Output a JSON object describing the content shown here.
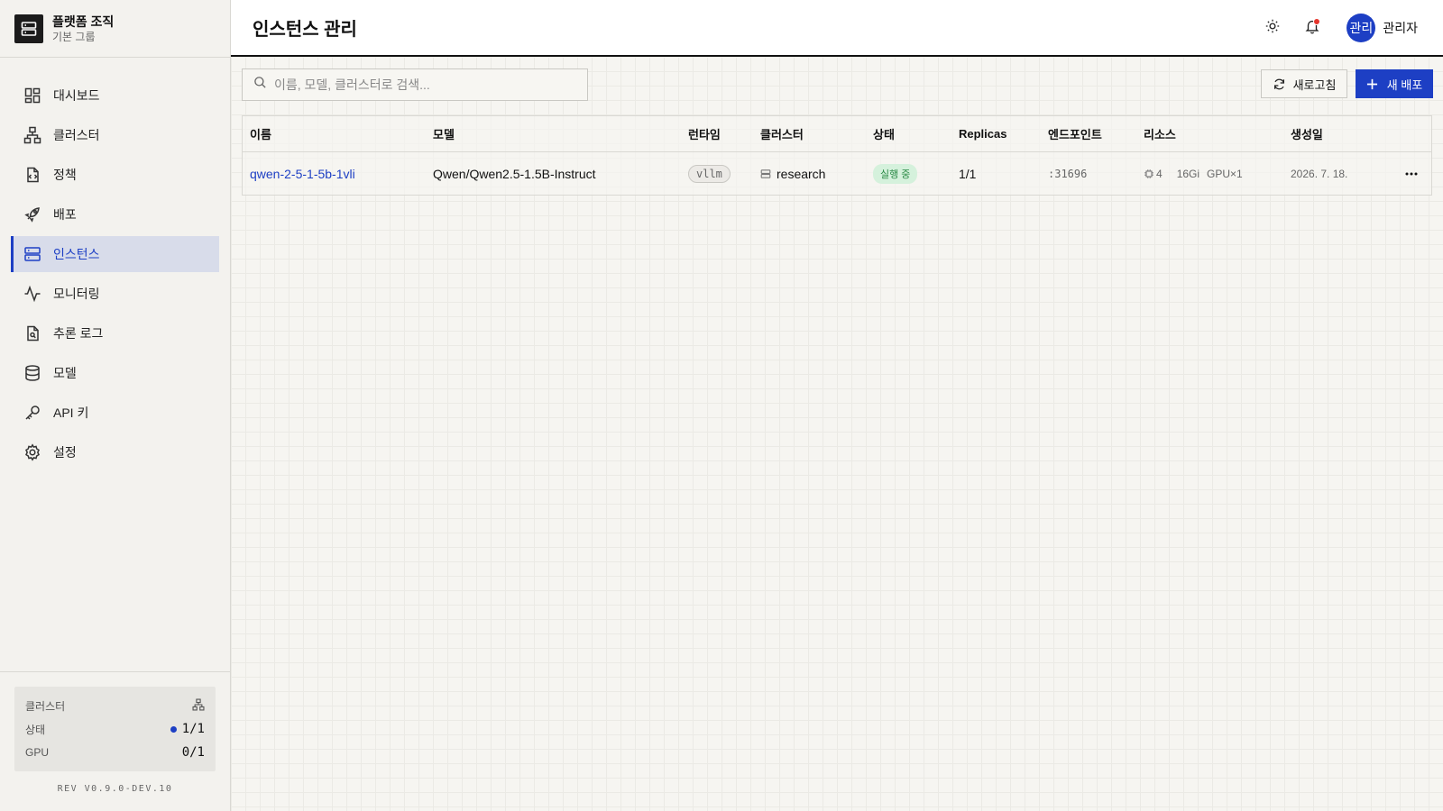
{
  "org": {
    "name": "플랫폼 조직",
    "group": "기본 그룹"
  },
  "nav": [
    {
      "label": "대시보드",
      "icon": "dashboard-icon"
    },
    {
      "label": "클러스터",
      "icon": "cluster-icon"
    },
    {
      "label": "정책",
      "icon": "policy-icon"
    },
    {
      "label": "배포",
      "icon": "rocket-icon"
    },
    {
      "label": "인스턴스",
      "icon": "server-icon",
      "active": true
    },
    {
      "label": "모니터링",
      "icon": "activity-icon"
    },
    {
      "label": "추론 로그",
      "icon": "log-icon"
    },
    {
      "label": "모델",
      "icon": "database-icon"
    },
    {
      "label": "API 키",
      "icon": "key-icon"
    },
    {
      "label": "설정",
      "icon": "gear-icon"
    }
  ],
  "cluster_summary": {
    "title": "클러스터",
    "status_label": "상태",
    "status_value": "1/1",
    "gpu_label": "GPU",
    "gpu_value": "0/1"
  },
  "revision": "REV V0.9.0-DEV.10",
  "header": {
    "title": "인스턴스 관리",
    "user_avatar": "관리",
    "user_name": "관리자"
  },
  "search": {
    "placeholder": "이름, 모델, 클러스터로 검색...",
    "value": ""
  },
  "toolbar": {
    "refresh_label": "새로고침",
    "new_deploy_label": "새 배포"
  },
  "table": {
    "columns": [
      "이름",
      "모델",
      "런타임",
      "클러스터",
      "상태",
      "Replicas",
      "엔드포인트",
      "리소스",
      "생성일"
    ],
    "rows": [
      {
        "name": "qwen-2-5-1-5b-1vli",
        "model": "Qwen/Qwen2.5-1.5B-Instruct",
        "runtime": "vllm",
        "cluster": "research",
        "status": "실행 중",
        "replicas": "1/1",
        "endpoint": ":31696",
        "cpu": "4",
        "memory": "16Gi",
        "gpu": "GPU×1",
        "created": "2026. 7. 18."
      }
    ]
  },
  "colors": {
    "accent": "#1d3fc4",
    "status_running_bg": "#d5f1dc",
    "status_running_fg": "#2a8a45",
    "notification_dot": "#e5342b"
  }
}
